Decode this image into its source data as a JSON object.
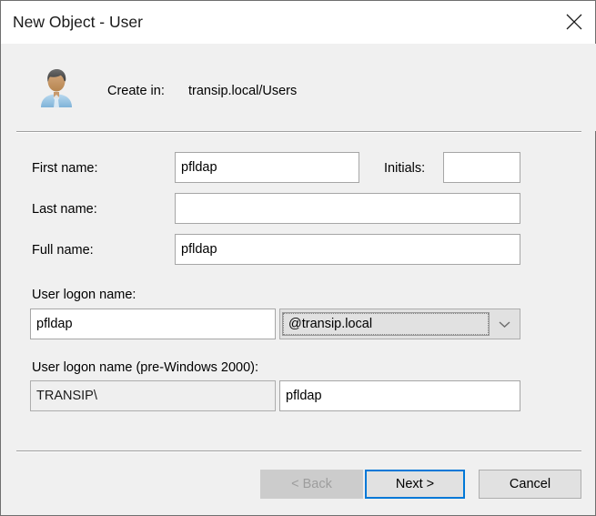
{
  "window": {
    "title": "New Object - User",
    "close_icon": "close-icon"
  },
  "header": {
    "avatar_icon": "user-avatar-icon",
    "create_in_label": "Create in:",
    "create_in_value": "transip.local/Users"
  },
  "form": {
    "first_name": {
      "label": "First name:",
      "value": "pfldap",
      "placeholder": ""
    },
    "initials": {
      "label": "Initials:",
      "value": "",
      "placeholder": ""
    },
    "last_name": {
      "label": "Last name:",
      "value": "",
      "placeholder": ""
    },
    "full_name": {
      "label": "Full name:",
      "value": "pfldap",
      "placeholder": ""
    },
    "logon_name": {
      "label": "User logon name:",
      "value": "pfldap",
      "placeholder": "",
      "domain_suffix": "@transip.local",
      "dropdown_icon": "chevron-down-icon"
    },
    "logon_name_pre2000": {
      "label": "User logon name (pre-Windows 2000):",
      "domain_prefix": "TRANSIP\\",
      "value": "pfldap",
      "placeholder": ""
    }
  },
  "footer": {
    "back_label": "< Back",
    "next_label": "Next >",
    "cancel_label": "Cancel"
  },
  "colors": {
    "accent": "#0078d7",
    "dialog_bg": "#f0f0f0",
    "titlebar_bg": "#ffffff",
    "field_border": "#a6a6a6",
    "button_bg": "#e1e1e1",
    "disabled_text": "#9d9d9d"
  }
}
